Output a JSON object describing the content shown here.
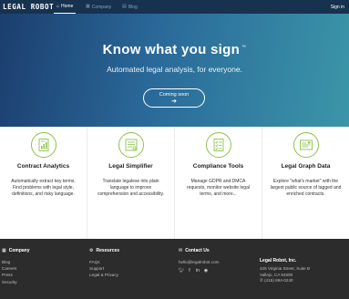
{
  "navbar": {
    "brand": "LEGAL ROBOT",
    "items": [
      {
        "label": "Home",
        "icon": "home-icon",
        "active": true
      },
      {
        "label": "Company",
        "icon": "building-icon",
        "active": false
      },
      {
        "label": "Blog",
        "icon": "blog-icon",
        "active": false
      }
    ],
    "signin": "Sign in"
  },
  "hero": {
    "title": "Know what you sign",
    "tm": "™",
    "subtitle": "Automated legal analysis, for everyone.",
    "cta_label": "Coming soon",
    "cta_arrow": "➔"
  },
  "features": [
    {
      "title": "Contract Analytics",
      "icon": "contract-analytics-icon",
      "desc": "Automatically extract key terms. Find problems with legal style, definitions, and risky language."
    },
    {
      "title": "Legal Simplifier",
      "icon": "simplifier-icon",
      "desc": "Translate legalese into plain language to improve comprehension and accessibility."
    },
    {
      "title": "Compliance Tools",
      "icon": "compliance-icon",
      "desc": "Manage GDPR and DMCA requests, monitor website legal terms, and more..."
    },
    {
      "title": "Legal Graph Data",
      "icon": "graph-data-icon",
      "desc": "Explore \"what's market\" with the largest public source of tagged and enriched contracts."
    }
  ],
  "footer": {
    "company": {
      "title": "Company",
      "links": [
        "Blog",
        "Careers",
        "Press",
        "Security"
      ]
    },
    "resources": {
      "title": "Resources",
      "links": [
        "FAQs",
        "Support",
        "Legal & Privacy"
      ]
    },
    "contact": {
      "title": "Contact Us",
      "email": "hello@legalrobot.com",
      "social": [
        "twitter-icon",
        "facebook-icon",
        "linkedin-icon",
        "github-icon"
      ]
    },
    "address": {
      "name": "Legal Robot, Inc.",
      "line1": "425 Virginia Street, Suite B",
      "line2": "Vallejo, CA 94590",
      "phone": "(415) 894-0240"
    }
  },
  "colors": {
    "nav_bg": "#17324f",
    "hero_start": "#1b3e6e",
    "hero_end": "#3b96a8",
    "icon_accent": "#8bc34a",
    "footer_bg": "#2c2c2c"
  }
}
